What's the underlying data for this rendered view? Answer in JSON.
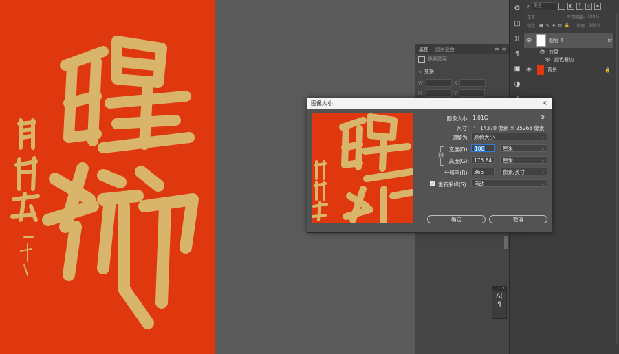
{
  "properties_panel": {
    "tabs": [
      "属性",
      "图层复合"
    ],
    "pixel_layer_label": "像素图层",
    "section_transform": "变换",
    "w_label": "W",
    "h_label": "H",
    "x_label": "X",
    "y_label": "Y"
  },
  "layers_panel": {
    "search_placeholder": "类型",
    "blend_mode": "正常",
    "opacity_label": "不透明度:",
    "opacity_value": "100%",
    "lock_label": "锁定:",
    "fill_label": "填充:",
    "fill_value": "100%",
    "layers": [
      {
        "name": "图层 4",
        "fx": "fx"
      },
      {
        "name": "效果"
      },
      {
        "name": "颜色叠加"
      },
      {
        "name": "背景"
      }
    ]
  },
  "dialog": {
    "title": "图像大小",
    "image_size_label": "图像大小:",
    "image_size_value": "1.01G",
    "dimensions_label": "尺寸:",
    "dimensions_value": "14370 像素  ×  25268 像素",
    "fit_to_label": "调整为:",
    "fit_to_value": "原稿大小",
    "width_label": "宽度(D):",
    "width_value": "100",
    "width_unit": "厘米",
    "height_label": "高度(G):",
    "height_value": "175.84",
    "height_unit": "厘米",
    "resolution_label": "分辨率(R):",
    "resolution_value": "365",
    "resolution_unit": "像素/英寸",
    "resample_label": "重新采样(S):",
    "resample_value": "自动",
    "ok_label": "确定",
    "cancel_label": "取消"
  },
  "canvas": {
    "side_text": "開門紅",
    "signature": "一可小十",
    "main_chars": "醒獅"
  },
  "char_panel": {
    "a_icon": "A|",
    "para_icon": "¶"
  },
  "colors": {
    "canvas_red": "#e0380e",
    "calligraphy_gold": "#d9b46b",
    "workspace_gray": "#5b5b5b",
    "accent_blue": "#2e7cd6"
  }
}
